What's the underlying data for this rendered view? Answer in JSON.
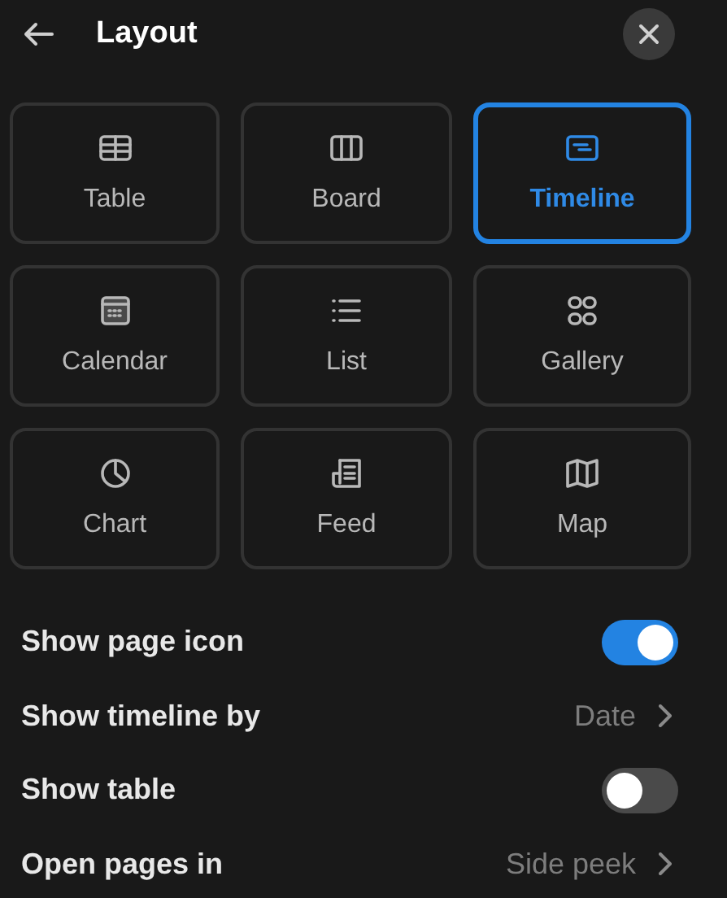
{
  "header": {
    "title": "Layout"
  },
  "layouts": [
    {
      "label": "Table",
      "selected": false
    },
    {
      "label": "Board",
      "selected": false
    },
    {
      "label": "Timeline",
      "selected": true
    },
    {
      "label": "Calendar",
      "selected": false
    },
    {
      "label": "List",
      "selected": false
    },
    {
      "label": "Gallery",
      "selected": false
    },
    {
      "label": "Chart",
      "selected": false
    },
    {
      "label": "Feed",
      "selected": false
    },
    {
      "label": "Map",
      "selected": false
    }
  ],
  "settings": [
    {
      "kind": "toggle",
      "label": "Show page icon",
      "on": true
    },
    {
      "kind": "select",
      "label": "Show timeline by",
      "value": "Date"
    },
    {
      "kind": "toggle",
      "label": "Show table",
      "on": false
    },
    {
      "kind": "select",
      "label": "Open pages in",
      "value": "Side peek"
    }
  ]
}
